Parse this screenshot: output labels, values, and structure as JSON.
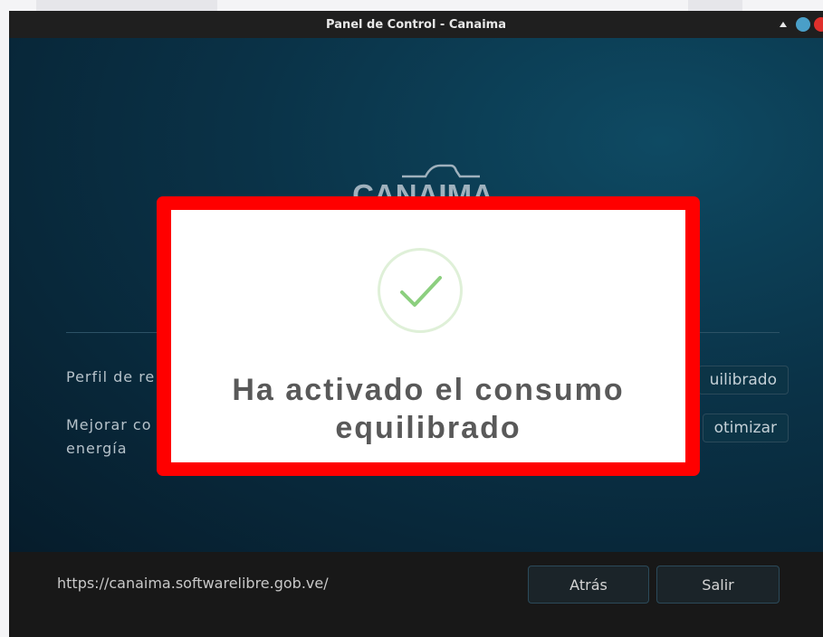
{
  "window": {
    "title": "Panel de Control - Canaima"
  },
  "brand": {
    "logo_text": "CANAIMA"
  },
  "settings": {
    "rows": [
      {
        "label": "Perfil de re",
        "button": "uilibrado"
      },
      {
        "label_line1": "Mejorar co",
        "label_line2": "energía",
        "button": "otimizar"
      }
    ]
  },
  "footer": {
    "url": "https://canaima.softwarelibre.gob.ve/",
    "back_label": "Atrás",
    "exit_label": "Salir"
  },
  "dialog": {
    "line1": "Ha activado el consumo",
    "line2": "equilibrado",
    "icon": "check-icon"
  },
  "colors": {
    "accent_red": "#ff0000",
    "success_green": "#8ccf7f",
    "panel_blue": "#0a3247"
  }
}
